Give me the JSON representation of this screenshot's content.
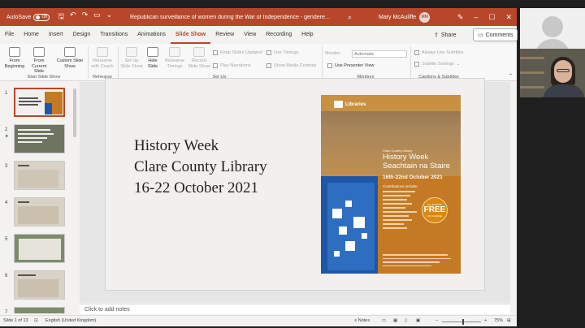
{
  "titlebar": {
    "autosave_label": "AutoSave",
    "autosave_state": "Off",
    "doc_title": "Republican surveillance of women during the War of Independence - gendered violence fr...",
    "user_name": "Mary McAuliffe",
    "user_initials": "MM"
  },
  "tabs": [
    "File",
    "Home",
    "Insert",
    "Design",
    "Transitions",
    "Animations",
    "Slide Show",
    "Review",
    "View",
    "Recording",
    "Help"
  ],
  "active_tab": "Slide Show",
  "share_label": "Share",
  "comments_label": "Comments",
  "ribbon": {
    "from_beginning": "From Beginning",
    "from_current": "From Current Slide",
    "custom_show": "Custom Slide Show",
    "group_start": "Start Slide Show",
    "rehearse_coach": "Rehearse with Coach",
    "group_rehearse": "Rehearse",
    "setup_show": "Set Up Slide Show",
    "hide_slide": "Hide Slide",
    "rehearse_timings": "Rehearse Timings",
    "record_show": "Record Slide Show",
    "keep_updated": "Keep Slides Updated",
    "play_narrations": "Play Narrations",
    "use_timings": "Use Timings",
    "show_media": "Show Media Controls",
    "group_setup": "Set Up",
    "monitor_label": "Monitor:",
    "monitor_value": "Automatic",
    "presenter_view": "Use Presenter View",
    "group_monitors": "Monitors",
    "always_subtitles": "Always Use Subtitles",
    "subtitle_settings": "Subtitle Settings",
    "group_captions": "Captions & Subtitles"
  },
  "thumbnails": [
    {
      "num": "1",
      "star": ""
    },
    {
      "num": "2",
      "star": "★"
    },
    {
      "num": "3",
      "star": ""
    },
    {
      "num": "4",
      "star": ""
    },
    {
      "num": "5",
      "star": ""
    },
    {
      "num": "6",
      "star": ""
    },
    {
      "num": "7",
      "star": ""
    }
  ],
  "slide": {
    "line1": "History Week",
    "line2": "Clare County Library",
    "line3": "16-22 October 2021"
  },
  "poster": {
    "libraries": "Libraries",
    "subtitle": "Clare County Library",
    "heading_en": "History Week",
    "heading_ga": "Seachtain na Staire",
    "dates": "16th-22nd October 2021",
    "contributors": "Contributions include:",
    "badge_small": "ALL EVENTS",
    "badge_big": "FREE",
    "badge_foot": "OF CHARGE"
  },
  "notes_placeholder": "Click to add notes",
  "statusbar": {
    "slide_info": "Slide 1 of 13",
    "language": "English (United Kingdom)",
    "notes": "Notes",
    "zoom": "75%"
  },
  "colors": {
    "brand": "#b7472a",
    "poster_orange": "#c47a24",
    "poster_blue": "#1f56a6"
  }
}
